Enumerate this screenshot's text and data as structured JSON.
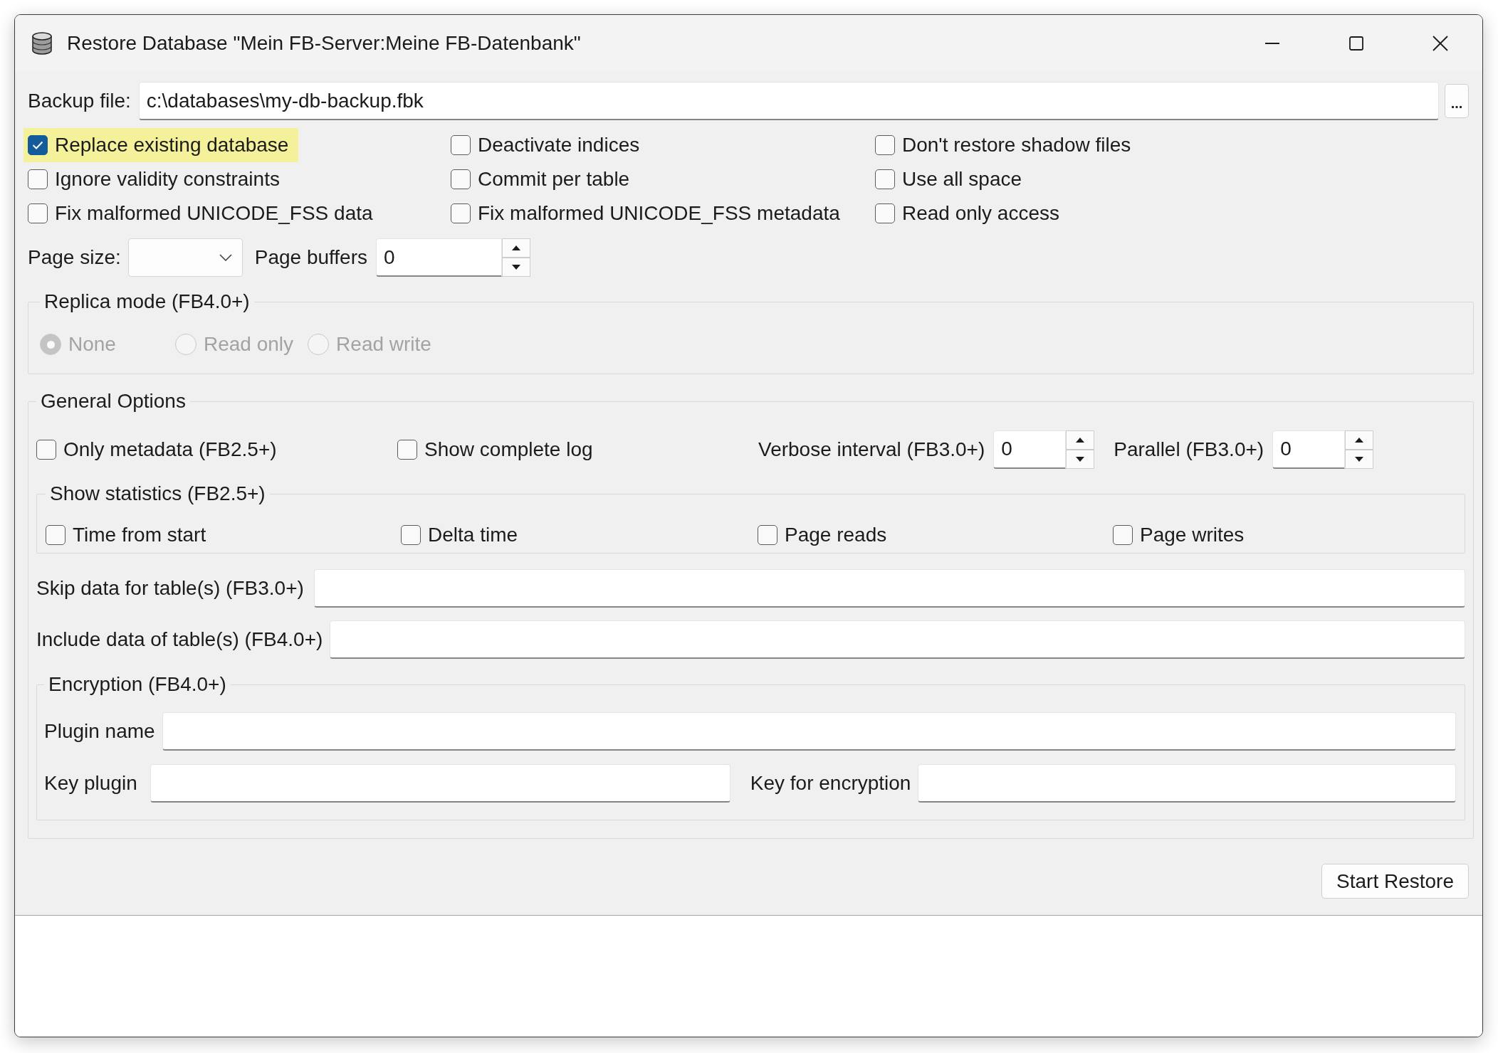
{
  "window": {
    "title": "Restore Database \"Mein FB-Server:Meine FB-Datenbank\""
  },
  "backup_file": {
    "label": "Backup file:",
    "value": "c:\\databases\\my-db-backup.fbk",
    "browse_button": "..."
  },
  "options": [
    {
      "label": "Replace existing database",
      "checked": true,
      "highlighted": true
    },
    {
      "label": "Deactivate indices",
      "checked": false,
      "highlighted": false
    },
    {
      "label": "Don't restore shadow files",
      "checked": false,
      "highlighted": false
    },
    {
      "label": "Ignore validity constraints",
      "checked": false,
      "highlighted": false
    },
    {
      "label": "Commit per table",
      "checked": false,
      "highlighted": false
    },
    {
      "label": "Use all space",
      "checked": false,
      "highlighted": false
    },
    {
      "label": "Fix malformed UNICODE_FSS data",
      "checked": false,
      "highlighted": false
    },
    {
      "label": "Fix malformed UNICODE_FSS metadata",
      "checked": false,
      "highlighted": false
    },
    {
      "label": "Read only access",
      "checked": false,
      "highlighted": false
    }
  ],
  "page_size": {
    "label": "Page size:"
  },
  "page_buffers": {
    "label": "Page buffers",
    "value": "0"
  },
  "replica_mode": {
    "title": "Replica mode (FB4.0+)",
    "disabled": true,
    "options": [
      {
        "label": "None",
        "selected": true
      },
      {
        "label": "Read only",
        "selected": false
      },
      {
        "label": "Read write",
        "selected": false
      }
    ]
  },
  "general_options": {
    "title": "General Options",
    "checkboxes": [
      {
        "label": "Only metadata (FB2.5+)",
        "checked": false
      },
      {
        "label": "Show complete log",
        "checked": false
      }
    ],
    "verbose_interval": {
      "label": "Verbose interval (FB3.0+)",
      "value": "0"
    },
    "parallel": {
      "label": "Parallel (FB3.0+)",
      "value": "0"
    },
    "show_statistics": {
      "title": "Show statistics (FB2.5+)",
      "options": [
        {
          "label": "Time from start",
          "checked": false
        },
        {
          "label": "Delta time",
          "checked": false
        },
        {
          "label": "Page reads",
          "checked": false
        },
        {
          "label": "Page writes",
          "checked": false
        }
      ]
    },
    "skip_data": {
      "label": "Skip data for table(s) (FB3.0+)"
    },
    "include_data": {
      "label": "Include data of table(s) (FB4.0+)"
    },
    "encryption": {
      "title": "Encryption (FB4.0+)",
      "plugin_name": {
        "label": "Plugin name"
      },
      "key_plugin": {
        "label": "Key plugin"
      },
      "key_for_encryption": {
        "label": "Key for encryption"
      }
    }
  },
  "start_button": {
    "label": "Start Restore"
  }
}
